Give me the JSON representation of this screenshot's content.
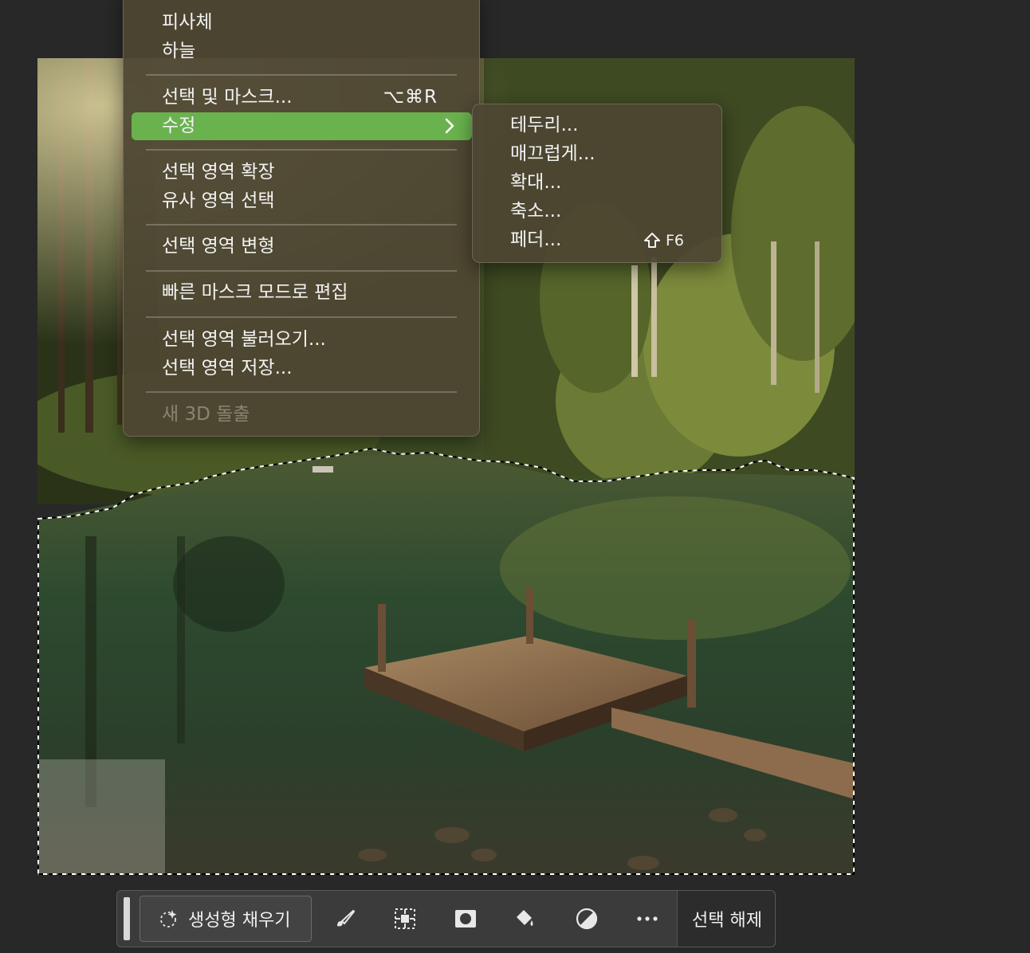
{
  "select_menu": {
    "partial_item": "피사체",
    "items": {
      "sky": "하늘",
      "select_and_mask": "선택 및 마스크...",
      "select_and_mask_shortcut": "⌥⌘R",
      "modify": "수정",
      "grow": "선택 영역 확장",
      "similar": "유사 영역 선택",
      "transform": "선택 영역 변형",
      "quick_mask": "빠른 마스크 모드로 편집",
      "load": "선택 영역 불러오기...",
      "save": "선택 영역 저장...",
      "new_3d": "새 3D 돌출"
    }
  },
  "modify_submenu": {
    "border": "테두리...",
    "smooth": "매끄럽게...",
    "expand": "확대...",
    "contract": "축소...",
    "feather": "페더...",
    "feather_shortcut": "F6"
  },
  "taskbar": {
    "generative_fill": "생성형 채우기",
    "deselect": "선택 해제",
    "icons": [
      "sparkle-icon",
      "brush-icon",
      "transform-selection-icon",
      "mask-icon",
      "paint-bucket-icon",
      "adjustment-icon",
      "more-icon"
    ]
  },
  "colors": {
    "highlight": "#6ab24e",
    "menu_bg": "#4e4632",
    "app_bg": "#282828"
  }
}
